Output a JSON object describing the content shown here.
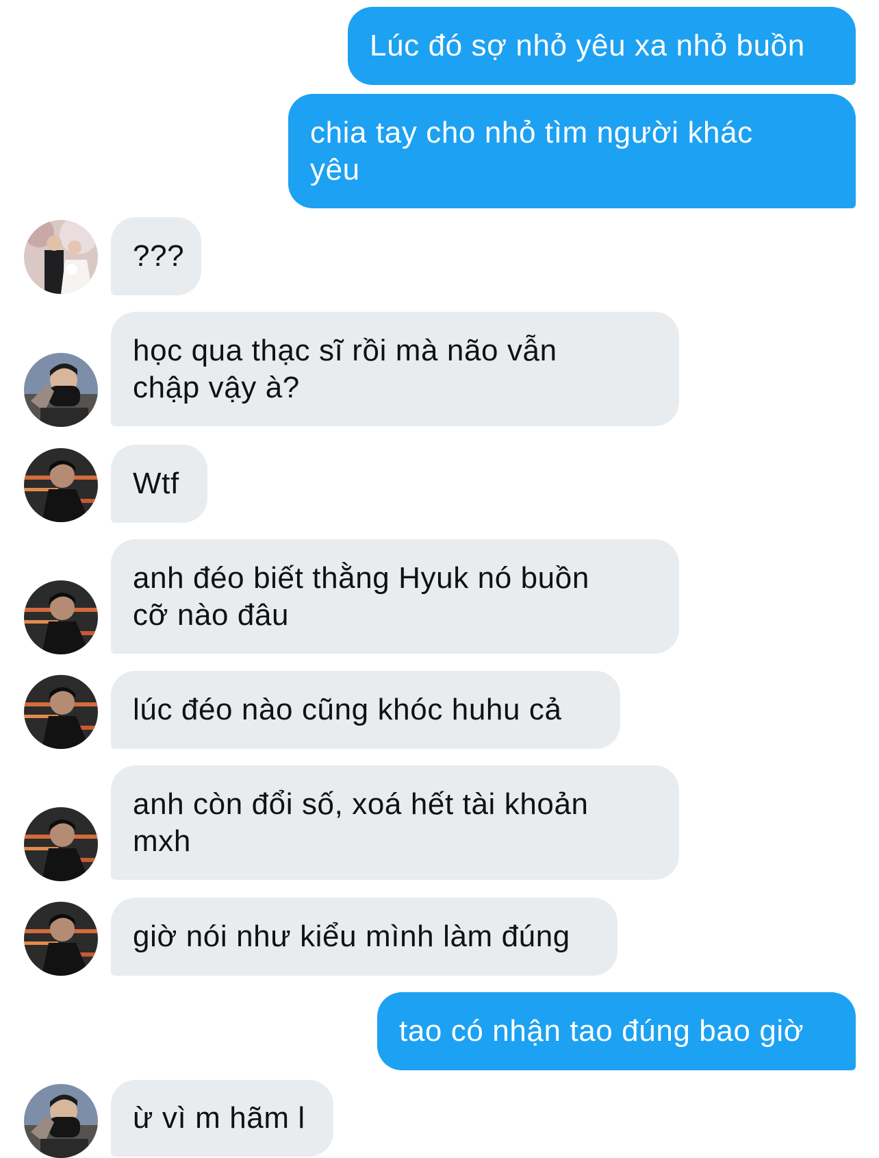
{
  "conversation": {
    "messages": [
      {
        "sender": "me",
        "text": "Lúc đó sợ nhỏ yêu xa nhỏ buồn"
      },
      {
        "sender": "me",
        "text": "chia tay cho nhỏ tìm người khác\nyêu"
      },
      {
        "sender": "wedding-avatar",
        "text": "???"
      },
      {
        "sender": "masked-avatar",
        "text": "học qua thạc sĩ rồi mà não vẫn\nchập vậy à?"
      },
      {
        "sender": "dark-avatar",
        "text": "Wtf"
      },
      {
        "sender": "dark-avatar",
        "text": "anh đéo biết thằng Hyuk nó buồn\ncỡ nào đâu"
      },
      {
        "sender": "dark-avatar",
        "text": "lúc đéo nào cũng khóc huhu cả"
      },
      {
        "sender": "dark-avatar",
        "text": "anh còn đổi số, xoá hết tài khoản\nmxh"
      },
      {
        "sender": "dark-avatar",
        "text": "giờ nói như kiểu mình làm đúng"
      },
      {
        "sender": "me",
        "text": "tao có nhận tao đúng bao giờ"
      },
      {
        "sender": "masked-avatar",
        "text": "ừ vì m hãm l"
      }
    ]
  },
  "colors": {
    "outgoing_bubble": "#1da1f2",
    "incoming_bubble": "#e8ecef",
    "outgoing_text": "#ffffff",
    "incoming_text": "#111111"
  }
}
